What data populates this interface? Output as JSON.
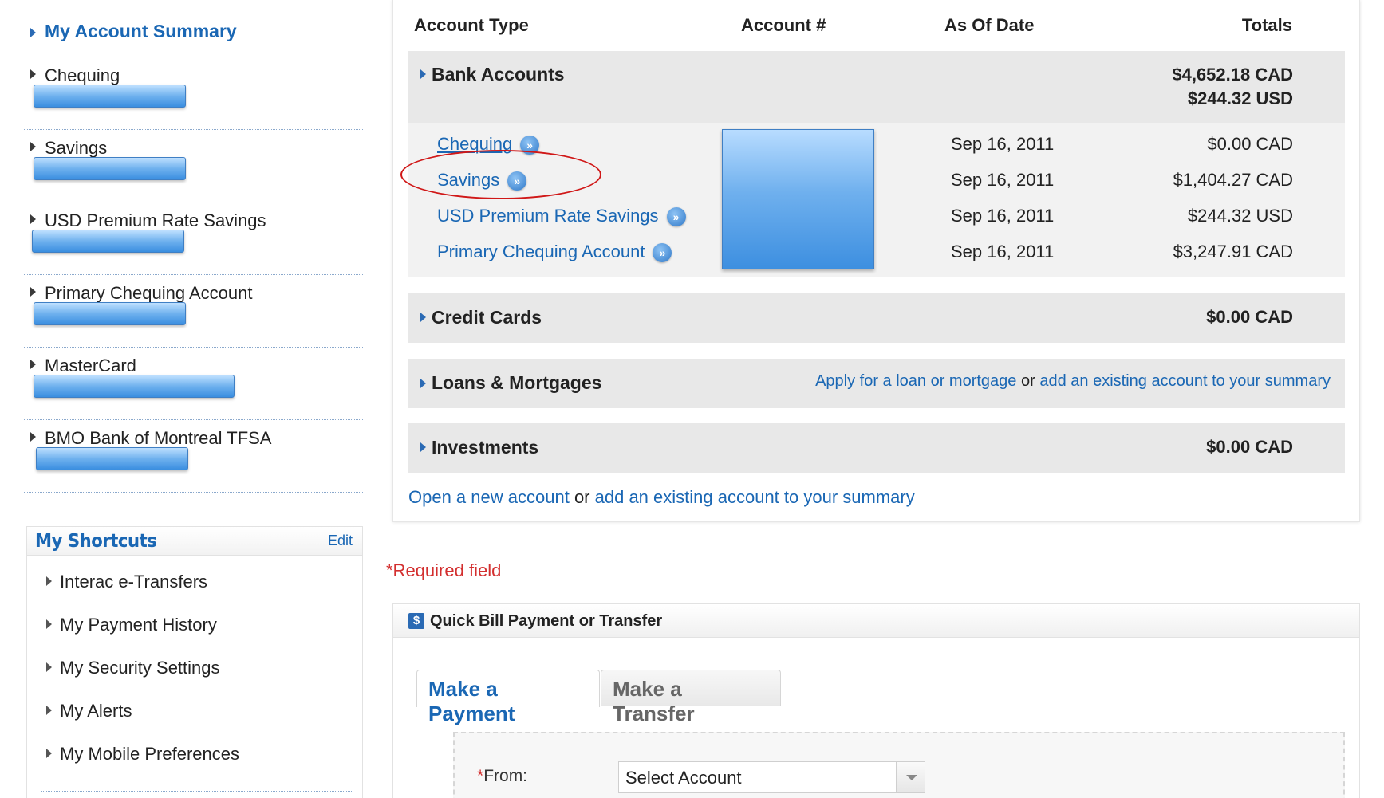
{
  "sidebar": {
    "summary_title": "My Account Summary",
    "accounts": [
      {
        "name": "Chequing"
      },
      {
        "name": "Savings"
      },
      {
        "name": "USD Premium Rate Savings"
      },
      {
        "name": "Primary Chequing Account"
      },
      {
        "name": "MasterCard"
      },
      {
        "name": "BMO Bank of Montreal TFSA"
      }
    ]
  },
  "shortcuts": {
    "title": "My Shortcuts",
    "edit_label": "Edit",
    "items": [
      "Interac e-Transfers",
      "My Payment History",
      "My Security Settings",
      "My Alerts",
      "My Mobile Preferences"
    ]
  },
  "summary_table": {
    "headers": {
      "account_type": "Account Type",
      "account_number": "Account #",
      "as_of_date": "As Of Date",
      "totals": "Totals"
    },
    "bank_accounts": {
      "title": "Bank Accounts",
      "total_cad": "$4,652.18 CAD",
      "total_usd": "$244.32 USD",
      "rows": [
        {
          "name": "Chequing",
          "date": "Sep 16, 2011",
          "amount": "$0.00 CAD"
        },
        {
          "name": "Savings",
          "date": "Sep 16, 2011",
          "amount": "$1,404.27 CAD"
        },
        {
          "name": "USD Premium Rate Savings",
          "date": "Sep 16, 2011",
          "amount": "$244.32 USD"
        },
        {
          "name": "Primary Chequing Account",
          "date": "Sep 16, 2011",
          "amount": "$3,247.91 CAD"
        }
      ]
    },
    "credit_cards": {
      "title": "Credit Cards",
      "total": "$0.00 CAD"
    },
    "loans": {
      "title": "Loans & Mortgages",
      "apply_link": "Apply for a loan or mortgage",
      "or": "or",
      "add_link": "add an existing account to your summary"
    },
    "investments": {
      "title": "Investments",
      "total": "$0.00 CAD"
    },
    "footer": {
      "open_link": "Open a new account",
      "or": "or",
      "add_link": "add an existing account to your summary"
    }
  },
  "required_note": "*Required field",
  "quick_bill": {
    "icon": "$",
    "title": "Quick Bill Payment or Transfer",
    "tabs": [
      "Make a Payment",
      "Make a Transfer"
    ],
    "from_star": "*",
    "from_label": "From:",
    "from_value": "Select Account"
  }
}
